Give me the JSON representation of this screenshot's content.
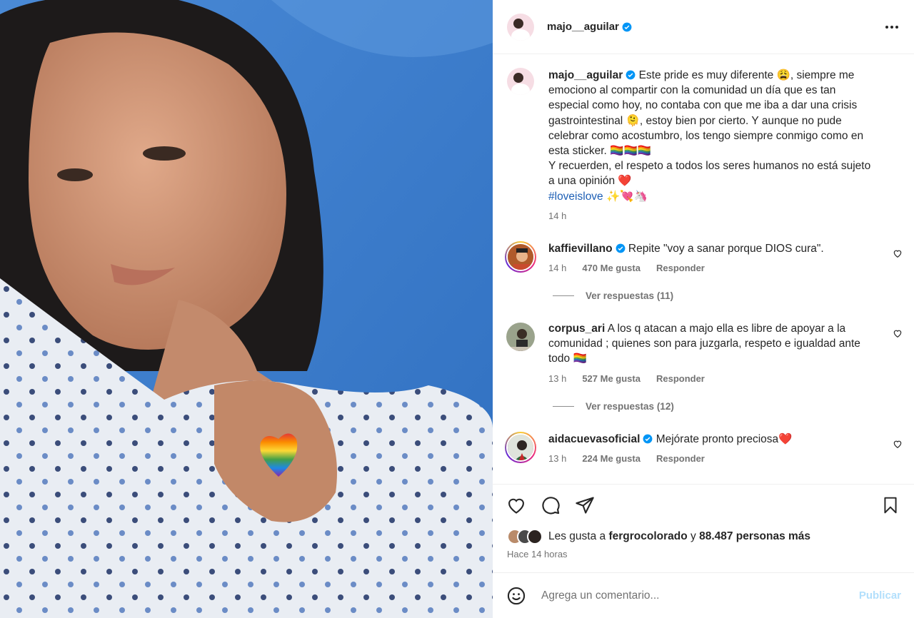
{
  "post": {
    "author": "majo__aguilar",
    "photo_description_icon": "selfie-photo"
  },
  "caption": {
    "username": "majo__aguilar",
    "line1": "Este pride es muy diferente 😩, siempre me emociono al compartir con la comunidad un día que es tan especial como hoy, no contaba con que me iba a dar una crisis gastrointestinal 🫠, estoy bien por cierto. Y aunque no pude celebrar como acostumbro, los tengo siempre conmigo como en esta sticker. 🏳️‍🌈🏳️‍🌈🏳️‍🌈",
    "line2": "Y recuerden, el respeto a todos los seres humanos no está sujeto a una opinión ❤️",
    "hashtag": "#loveislove",
    "hashtag_emoji": " ✨💘🦄",
    "time": "14 h"
  },
  "comments": [
    {
      "username": "kaffievillano",
      "text": "Repite \"voy a sanar porque DIOS cura\".",
      "time": "14 h",
      "likes": "470 Me gusta",
      "reply": "Responder",
      "replies": "Ver respuestas (11)"
    },
    {
      "username": "corpus_ari",
      "text": "A los q atacan a majo ella es libre de apoyar a la comunidad ; quienes son para juzgarla, respeto e igualdad ante todo 🏳️‍🌈",
      "time": "13 h",
      "likes": "527 Me gusta",
      "reply": "Responder",
      "replies": "Ver respuestas (12)"
    },
    {
      "username": "aidacuevasoficial",
      "text": "Mejórate pronto preciosa❤️",
      "time": "13 h",
      "likes": "224 Me gusta",
      "reply": "Responder"
    }
  ],
  "likes": {
    "prefix": "Les gusta a ",
    "user": "fergrocolorado",
    "middle": " y ",
    "count": "88.487 personas más"
  },
  "time_ago": "Hace 14 horas",
  "add_comment": {
    "placeholder": "Agrega un comentario...",
    "publish": "Publicar"
  },
  "colors": {
    "verified": "#0095f6",
    "link": "#1d5fb5",
    "publish_disabled": "#b2dffc"
  }
}
